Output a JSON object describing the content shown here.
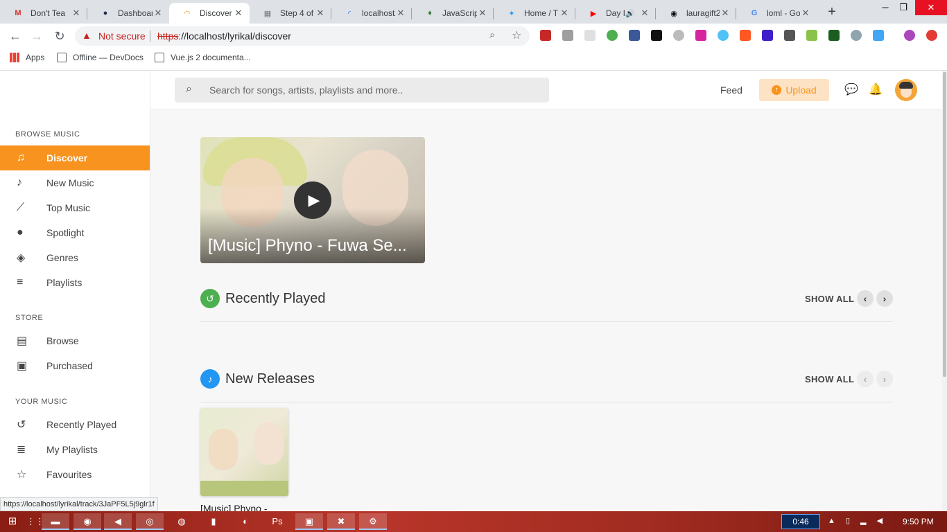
{
  "browser": {
    "tabs": [
      {
        "title": "Don't Tea",
        "favicon": "M"
      },
      {
        "title": "Dashboar",
        "favicon": "●"
      },
      {
        "title": "Discover",
        "favicon": "◠"
      },
      {
        "title": "Step 4 of",
        "favicon": "▦"
      },
      {
        "title": "localhost/",
        "favicon": "◜"
      },
      {
        "title": "JavaScript",
        "favicon": "♦"
      },
      {
        "title": "Home / T",
        "favicon": "✦"
      },
      {
        "title": "Day I",
        "favicon": "▶"
      },
      {
        "title": "lauragift2",
        "favicon": "◉"
      },
      {
        "title": "loml - Go",
        "favicon": "G"
      }
    ],
    "close_glyph": "✕",
    "new_tab_glyph": "+",
    "window_controls": [
      "─",
      "❐",
      "✕"
    ],
    "security_label": "Not secure",
    "url_scheme": "https",
    "url_rest": "://localhost/lyrikal/discover",
    "bookmarks": [
      "Apps",
      "Offline — DevDocs",
      "Vue.js 2 documenta..."
    ],
    "status_url": "https://localhost/lyrikal/track/3JaPF5L5j9glr1f"
  },
  "sidebar": {
    "browse_heading": "BROWSE MUSIC",
    "browse_items": [
      {
        "label": "Discover",
        "icon": "♫"
      },
      {
        "label": "New Music",
        "icon": "♪"
      },
      {
        "label": "Top Music",
        "icon": "⟋"
      },
      {
        "label": "Spotlight",
        "icon": "●"
      },
      {
        "label": "Genres",
        "icon": "◈"
      },
      {
        "label": "Playlists",
        "icon": "≡"
      }
    ],
    "store_heading": "STORE",
    "store_items": [
      {
        "label": "Browse",
        "icon": "▤"
      },
      {
        "label": "Purchased",
        "icon": "▣"
      }
    ],
    "your_heading": "YOUR MUSIC",
    "your_items": [
      {
        "label": "Recently Played",
        "icon": "↺"
      },
      {
        "label": "My Playlists",
        "icon": "≣"
      },
      {
        "label": "Favourites",
        "icon": "☆"
      }
    ]
  },
  "topbar": {
    "search_placeholder": "Search for songs, artists, playlists and more..",
    "feed_label": "Feed",
    "upload_label": "Upload"
  },
  "hero": {
    "title": "[Music] Phyno - Fuwa Se..."
  },
  "sections": {
    "recently_played": {
      "title": "Recently Played",
      "show_all": "SHOW ALL",
      "color": "#4caf50"
    },
    "new_releases": {
      "title": "New Releases",
      "show_all": "SHOW ALL",
      "color": "#2196f3"
    }
  },
  "new_release_card": {
    "title": "[Music] Phyno -"
  },
  "taskbar": {
    "timer": "0:46",
    "time": "9:50 PM"
  }
}
